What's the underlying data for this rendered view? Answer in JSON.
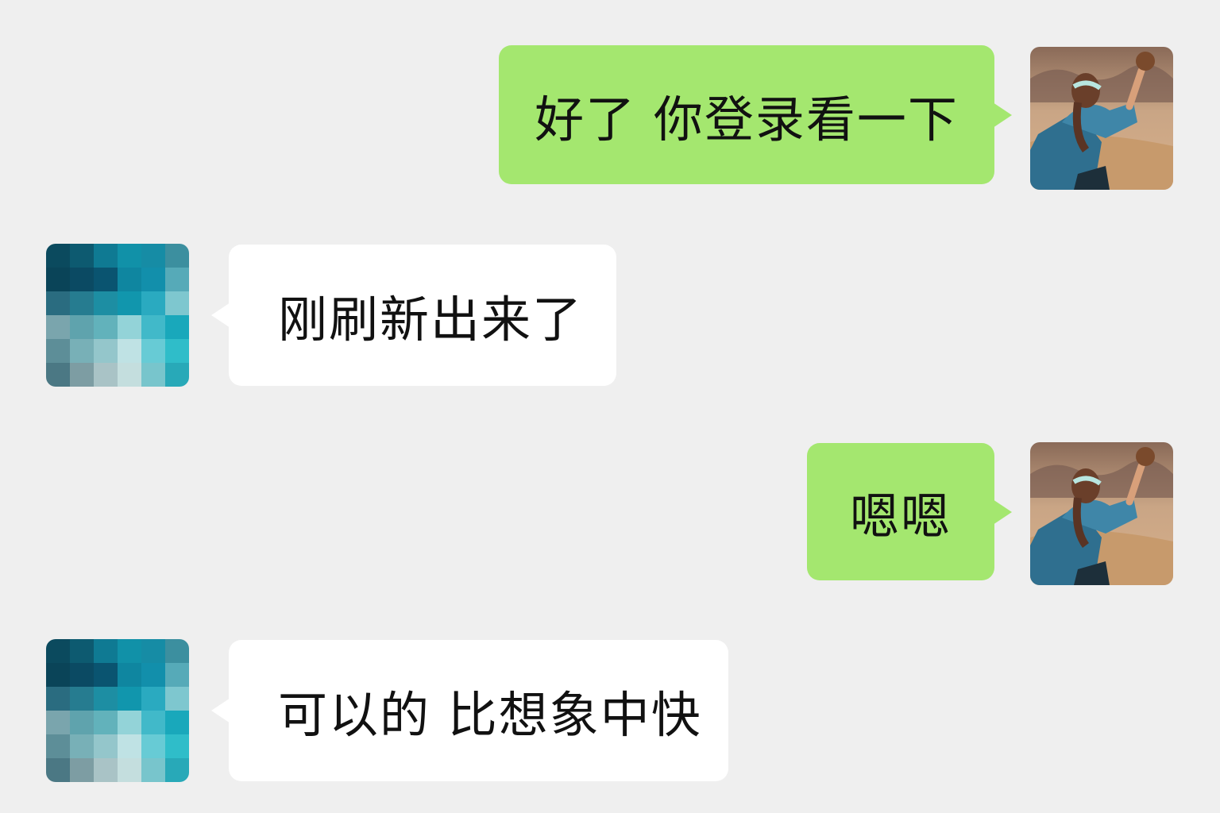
{
  "chat": {
    "messages": [
      {
        "side": "sent",
        "text": "好了 你登录看一下",
        "avatar": "self-avatar-photo"
      },
      {
        "side": "received",
        "text": "刚刷新出来了",
        "avatar": "contact-avatar-pixelated"
      },
      {
        "side": "sent",
        "text": "嗯嗯",
        "avatar": "self-avatar-photo"
      },
      {
        "side": "received",
        "text": "可以的 比想象中快",
        "avatar": "contact-avatar-pixelated"
      }
    ]
  },
  "colors": {
    "background": "#efefef",
    "sent_bubble": "#a4e76f",
    "received_bubble": "#ffffff",
    "text": "#111111"
  }
}
